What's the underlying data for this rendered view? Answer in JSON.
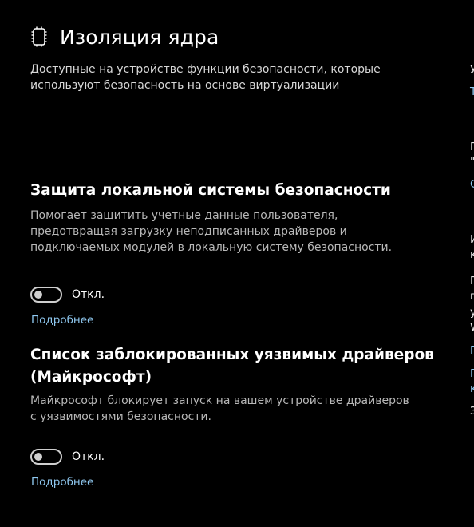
{
  "header": {
    "title": "Изоляция ядра",
    "icon": "core-isolation-chip-icon"
  },
  "intro": "Доступные на устройстве функции безопасности, которые используют безопасность на основе виртуализации",
  "sections": [
    {
      "title": "Защита локальной системы безопасности",
      "description": "Помогает защитить учетные данные пользователя, предотвращая загрузку неподписанных драйверов и подключаемых модулей в локальную систему безопасности.",
      "toggle_state": "Откл.",
      "toggle_on": false,
      "link": "Подробнее"
    },
    {
      "title": "Список заблокированных уязвимых драйверов (Майкрософт)",
      "description": "Майкрософт блокирует запуск на вашем устройстве драйверов с уязвимостями безопасности.",
      "toggle_state": "Откл.",
      "toggle_on": false,
      "link": "Подробнее"
    }
  ],
  "right_column": {
    "fragments": [
      "У",
      "Т",
      "П",
      "\"",
      "С",
      "И",
      "к",
      "П",
      "п",
      "у",
      "W",
      "П",
      "П",
      "к",
      "З"
    ]
  },
  "colors": {
    "background": "#000000",
    "link": "#8fc8f0",
    "text": "#ffffff",
    "secondary_text": "#b8b8b8"
  }
}
